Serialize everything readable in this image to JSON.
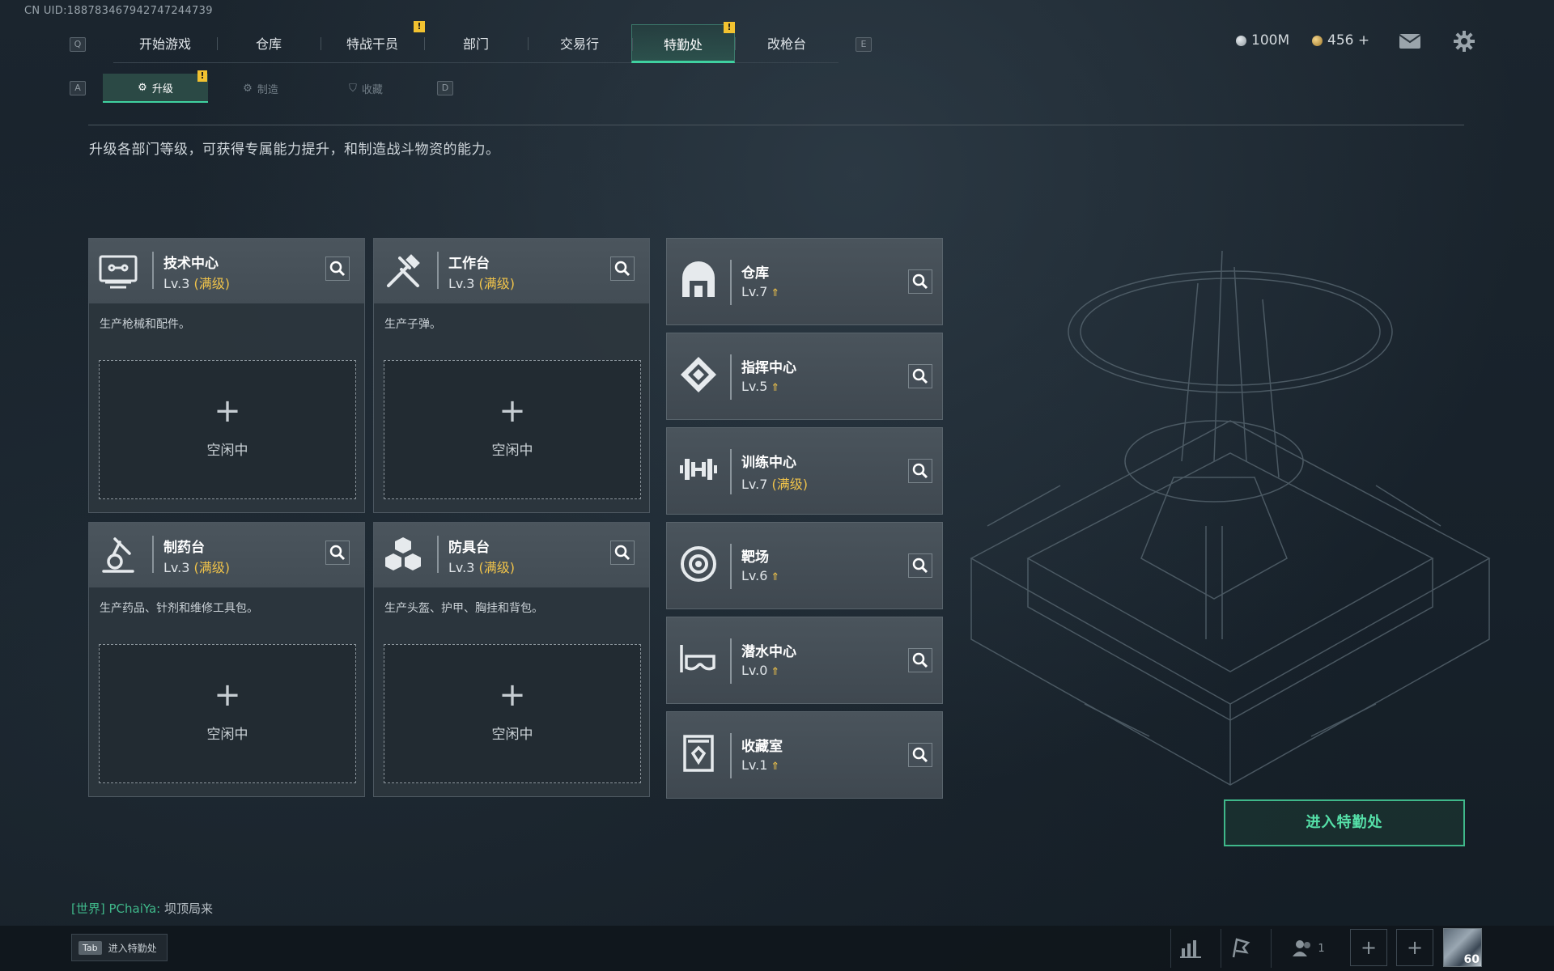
{
  "uid_text": "CN UID:18878346794274​7244739",
  "nav": {
    "prev_key": "Q",
    "next_key": "E",
    "tabs": [
      {
        "label": "开始游戏"
      },
      {
        "label": "仓库"
      },
      {
        "label": "特战干员",
        "alert": "!"
      },
      {
        "label": "部门"
      },
      {
        "label": "交易行"
      },
      {
        "label": "特勤处",
        "alert": "!"
      },
      {
        "label": "改枪台"
      }
    ]
  },
  "currency": {
    "silver": "100M",
    "gold": "456 +"
  },
  "subnav": {
    "prev_key": "A",
    "next_key": "D",
    "tabs": [
      {
        "label": "升级",
        "alert": "!"
      },
      {
        "label": "制造"
      },
      {
        "label": "收藏"
      }
    ]
  },
  "description": "升级各部门等级，可获得专属能力提升，和制造战斗物资的能力。",
  "production": [
    {
      "name": "技术中心",
      "level": "Lv.3",
      "max": "(满级)",
      "desc": "生产枪械和配件。",
      "plus": "+",
      "status": "空闲中",
      "icon": "tech-center-icon"
    },
    {
      "name": "工作台",
      "level": "Lv.3",
      "max": "(满级)",
      "desc": "生产子弹。",
      "plus": "+",
      "status": "空闲中",
      "icon": "workbench-icon"
    },
    {
      "name": "制药台",
      "level": "Lv.3",
      "max": "(满级)",
      "desc": "生产药品、针剂和维修工具包。",
      "plus": "+",
      "status": "空闲中",
      "icon": "pharmacy-icon"
    },
    {
      "name": "防具台",
      "level": "Lv.3",
      "max": "(满级)",
      "desc": "生产头盔、护甲、胸挂和背包。",
      "plus": "+",
      "status": "空闲中",
      "icon": "armor-bench-icon"
    }
  ],
  "facilities": [
    {
      "name": "仓库",
      "level": "Lv.7",
      "extra": "",
      "upgradable": true,
      "icon": "warehouse-icon"
    },
    {
      "name": "指挥中心",
      "level": "Lv.5",
      "extra": "",
      "upgradable": true,
      "icon": "command-center-icon"
    },
    {
      "name": "训练中心",
      "level": "Lv.7",
      "extra": "(满级)",
      "upgradable": false,
      "icon": "training-center-icon"
    },
    {
      "name": "靶场",
      "level": "Lv.6",
      "extra": "",
      "upgradable": true,
      "icon": "shooting-range-icon"
    },
    {
      "name": "潜水中心",
      "level": "Lv.0",
      "extra": "",
      "upgradable": true,
      "icon": "diving-center-icon"
    },
    {
      "name": "收藏室",
      "level": "Lv.1",
      "extra": "",
      "upgradable": true,
      "icon": "collection-room-icon"
    }
  ],
  "enter_button": "进入特勤处",
  "chat": {
    "channel": "[世界]",
    "name": "PChaiYa:",
    "message": "坝顶局来"
  },
  "bottom": {
    "tab_key": "Tab",
    "tab_label": "进入特勤处",
    "friends_count": "1",
    "player_level": "60"
  },
  "colors": {
    "accent": "#3fd1a0",
    "max_level": "#f0c34a",
    "alert": "#f2c230"
  }
}
